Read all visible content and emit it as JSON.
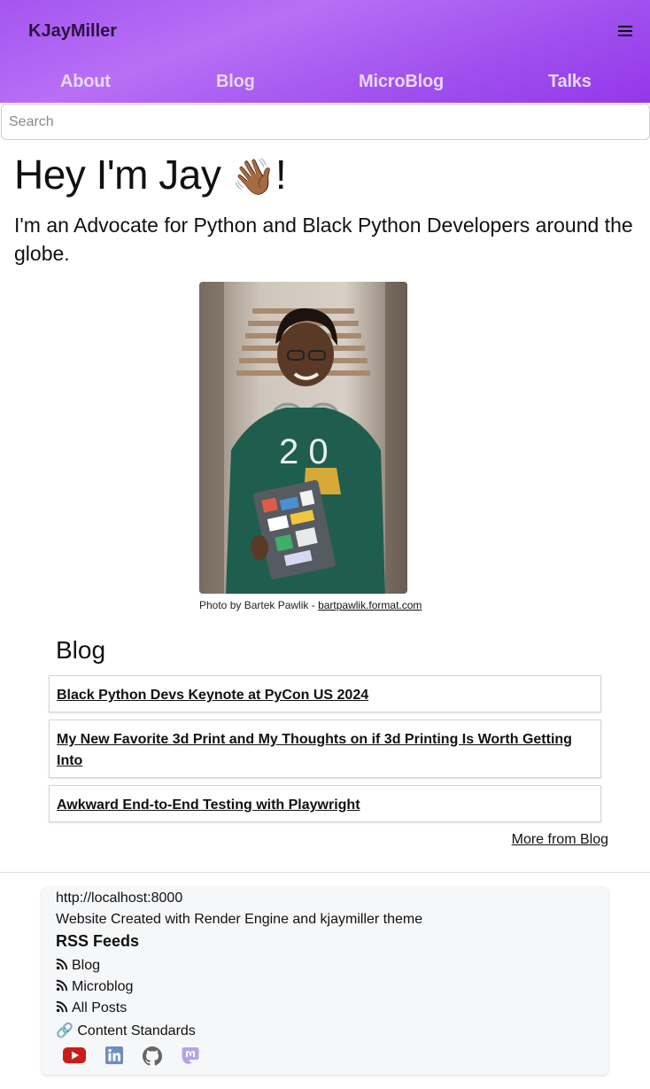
{
  "header": {
    "brand": "KJayMiller",
    "menu_icon": "hamburger-icon",
    "nav": [
      "About",
      "Blog",
      "MicroBlog",
      "Talks"
    ]
  },
  "search": {
    "placeholder": "Search",
    "value": ""
  },
  "hero": {
    "title": "Hey I'm Jay ",
    "emoji": "👋🏾",
    "title_end": "!",
    "subtitle": "I'm an Advocate for Python and Black Python Developers around the globe."
  },
  "photo": {
    "caption_prefix": "Photo by Bartek Pawlik - ",
    "caption_link": "bartpawlik.format.com"
  },
  "blog": {
    "heading": "Blog",
    "posts": [
      "Black Python Devs Keynote at PyCon US 2024",
      "My New Favorite 3d Print and My Thoughts on if 3d Printing Is Worth Getting Into",
      "Awkward End-to-End Testing with Playwright"
    ],
    "more_link": "More from Blog"
  },
  "footer": {
    "url": "http://localhost:8000",
    "credit": "Website Created with Render Engine and kjaymiller theme",
    "rss_title": "RSS Feeds",
    "rss_links": [
      "Blog",
      "Microblog",
      "All Posts"
    ],
    "standards_emoji": "🔗",
    "standards": " Content Standards",
    "social_icons": [
      "youtube-icon",
      "linkedin-icon",
      "github-icon",
      "mastodon-icon"
    ]
  },
  "colors": {
    "header_gradient_start": "#a455f0",
    "header_gradient_end": "#9438ea",
    "youtube": "#cc1d1d",
    "linkedin": "#6e8fbd",
    "github": "#666666",
    "mastodon": "#b7a4e6"
  }
}
